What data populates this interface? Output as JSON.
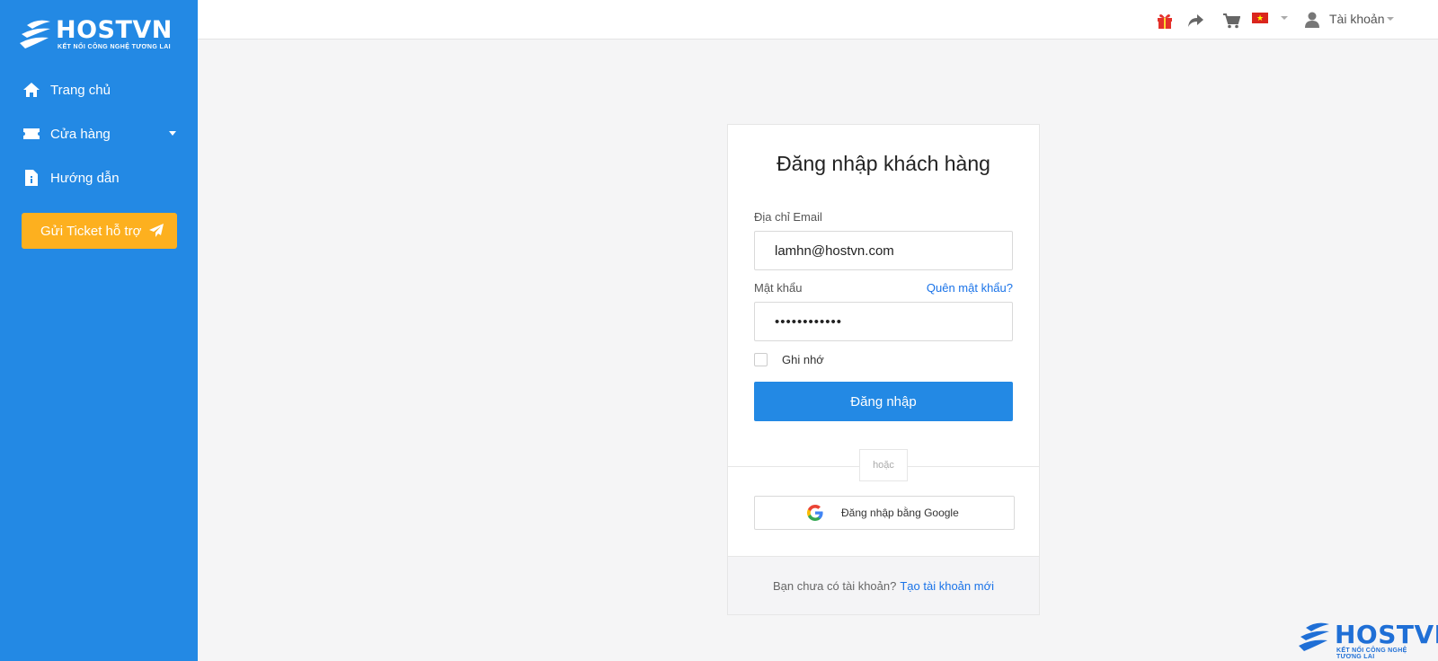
{
  "brand": {
    "name": "HOSTVN",
    "tagline": "KẾT NỐI CÔNG NGHỆ TƯƠNG LAI"
  },
  "sidebar": {
    "items": [
      {
        "label": "Trang chủ",
        "icon": "home-icon"
      },
      {
        "label": "Cửa hàng",
        "icon": "store-icon"
      },
      {
        "label": "Hướng dẫn",
        "icon": "document-icon"
      }
    ],
    "ticket_button": "Gửi Ticket hỗ trợ"
  },
  "topbar": {
    "icons": [
      "gift-icon",
      "share-icon",
      "cart-icon",
      "vietnam-flag-icon",
      "user-icon"
    ],
    "account_label": "Tài khoản"
  },
  "login": {
    "title": "Đăng nhập khách hàng",
    "email_label": "Địa chỉ Email",
    "email_value": "lamhn@hostvn.com",
    "password_label": "Mật khẩu",
    "password_value": "••••••••••••",
    "forgot_link": "Quên mật khẩu?",
    "remember_label": "Ghi nhớ",
    "submit_label": "Đăng nhập",
    "or_text": "hoặc",
    "google_label": "Đăng nhập bằng Google",
    "footer_text": "Bạn chưa có tài khoản?",
    "create_link": "Tạo tài khoản mới"
  },
  "colors": {
    "sidebar": "#2389e4",
    "ticket_button": "#fdb01f",
    "primary": "#2389e4",
    "link": "#1a73e8"
  }
}
